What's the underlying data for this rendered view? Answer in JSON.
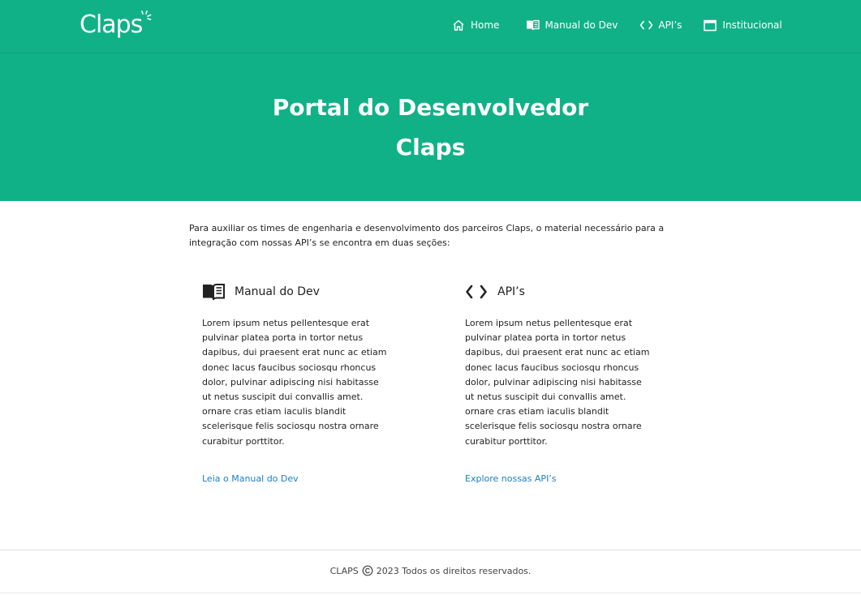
{
  "header": {
    "logo_text": "Claps",
    "nav": [
      {
        "label": "Home",
        "icon": "home-icon"
      },
      {
        "label": "Manual do Dev",
        "icon": "book-icon"
      },
      {
        "label": "API’s",
        "icon": "code-icon"
      },
      {
        "label": "Institucional",
        "icon": "window-icon"
      }
    ]
  },
  "hero": {
    "title_line1": "Portal do Desenvolvedor",
    "title_line2": "Claps"
  },
  "intro": {
    "text": "Para auxiliar os times de engenharia e desenvolvimento dos parceiros Claps, o material necessário para a integração com nossas API’s se encontra em duas seções:"
  },
  "cards": [
    {
      "icon": "book-icon",
      "title": "Manual do Dev",
      "text": "Lorem ipsum netus pellentesque erat pulvinar platea porta in tortor netus dapibus, dui praesent erat nunc ac etiam donec lacus faucibus sociosqu rhoncus dolor, pulvinar adipiscing nisi habitasse ut netus suscipit dui convallis amet. ornare cras etiam iaculis blandit scelerisque felis sociosqu nostra ornare curabitur porttitor.",
      "link": "Leia o Manual do Dev"
    },
    {
      "icon": "code-icon",
      "title": "API’s",
      "text": "Lorem ipsum netus pellentesque erat pulvinar platea porta in tortor netus dapibus, dui praesent erat nunc ac etiam donec lacus faucibus sociosqu rhoncus dolor, pulvinar adipiscing nisi habitasse ut netus suscipit dui convallis amet. ornare cras etiam iaculis blandit scelerisque felis sociosqu nostra ornare curabitur porttitor.",
      "link": "Explore nossas API’s"
    }
  ],
  "footer": {
    "brand": "CLAPS",
    "copyright_icon": "copyright-icon",
    "text": "2023 Todos os direitos reservados."
  },
  "colors": {
    "brand_green": "#10b187",
    "link_blue": "#1a7fc1"
  }
}
